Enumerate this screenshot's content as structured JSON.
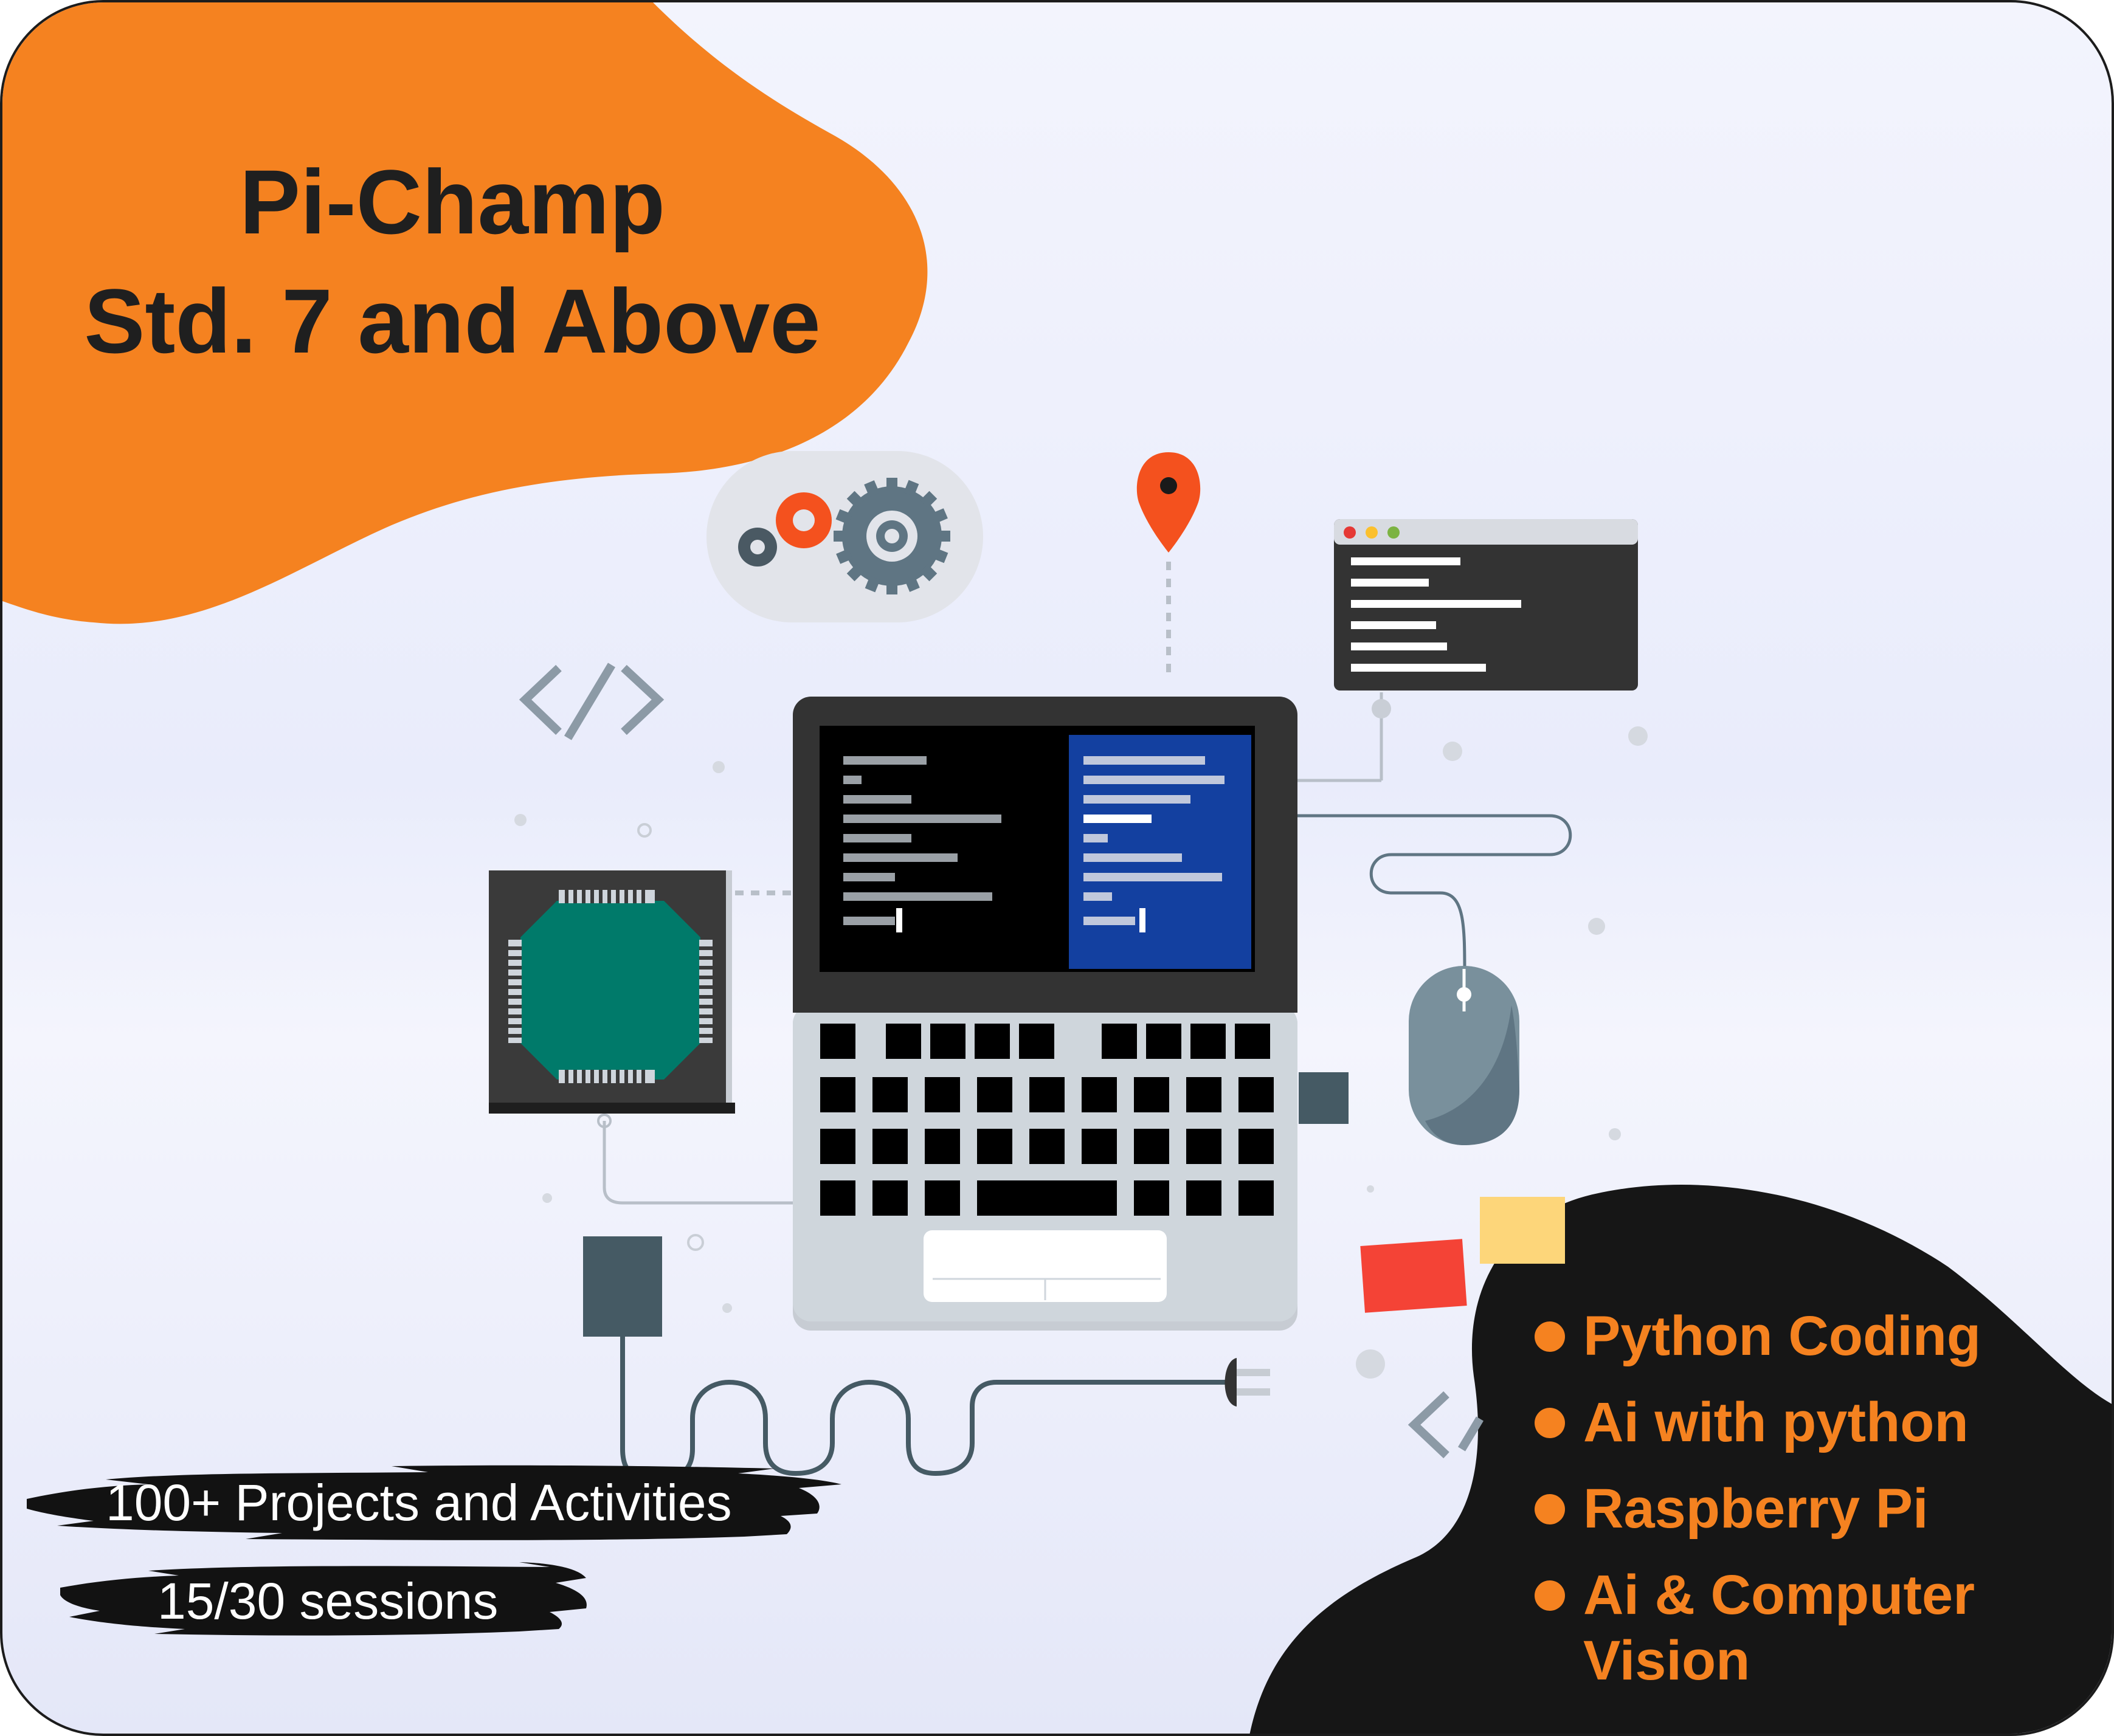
{
  "header": {
    "title_line1": "Pi-Champ",
    "title_line2": "Std. 7 and Above"
  },
  "features": [
    "Python Coding",
    "Ai with python",
    "Raspberry Pi",
    "Ai & Computer Vision"
  ],
  "badges": {
    "projects": "100+ Projects and Activities",
    "sessions": "15/30 sessions"
  },
  "colors": {
    "orange": "#f58220",
    "black": "#1a1a1a",
    "chip_green": "#007a6a",
    "screen_blue": "#1340a0"
  },
  "icons": [
    "gears-icon",
    "location-pin-icon",
    "code-icon",
    "terminal-window-icon",
    "laptop-icon",
    "processor-chip-icon",
    "mouse-icon",
    "power-adapter-icon",
    "plug-icon",
    "sticky-notes-icon"
  ]
}
